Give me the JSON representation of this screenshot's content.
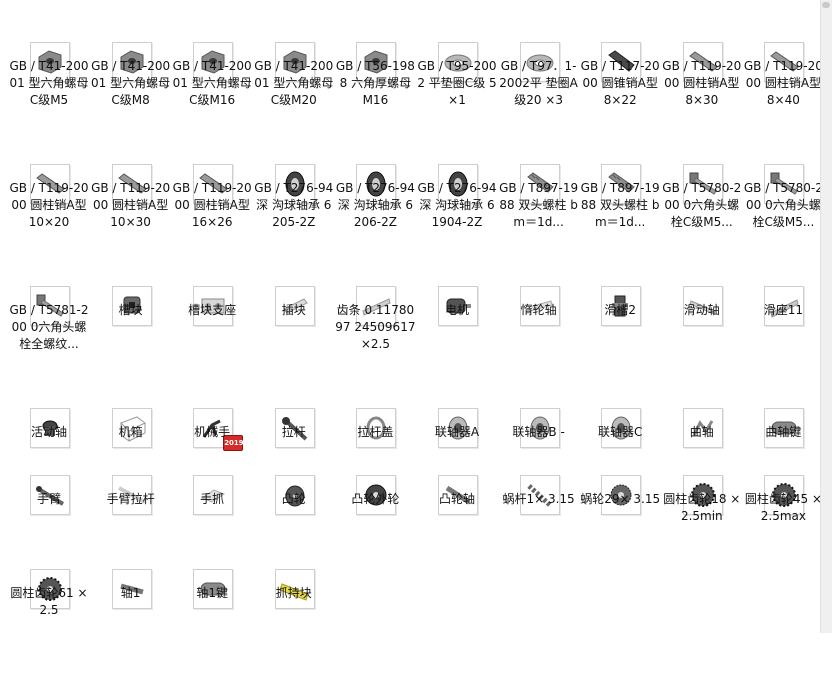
{
  "items": [
    {
      "label": "GB / T41-20001 型六角螺母 C级M5",
      "icon": "hex-nut-icon"
    },
    {
      "label": "GB / T41-20001 型六角螺母 C级M8",
      "icon": "hex-nut-icon"
    },
    {
      "label": "GB / T41-20001 型六角螺母 C级M16",
      "icon": "hex-nut-icon"
    },
    {
      "label": "GB / T41-20001 型六角螺母 C级M20",
      "icon": "hex-nut-icon"
    },
    {
      "label": "GB / T56-1988 六角厚螺母 M16",
      "icon": "hex-nut-icon"
    },
    {
      "label": "GB / T95-2002 平垫圈C级 5×1",
      "icon": "washer-icon"
    },
    {
      "label": "GB / T97．1-2002平 垫圈A级20 ×3",
      "icon": "washer-icon"
    },
    {
      "label": "GB / T117-2000 圆锥销A型 8×22",
      "icon": "taper-pin-icon"
    },
    {
      "label": "GB / T119-2000 圆柱销A型 8×30",
      "icon": "cylinder-pin-icon"
    },
    {
      "label": "GB / T119-2000 圆柱销A型 8×40",
      "icon": "cylinder-pin-icon"
    },
    {
      "label": "GB / T119-2000 圆柱销A型 10×20",
      "icon": "cylinder-pin-icon"
    },
    {
      "label": "GB / T119-2000 圆柱销A型 10×30",
      "icon": "cylinder-pin-icon"
    },
    {
      "label": "GB / T119-2000 圆柱销A型 16×26",
      "icon": "cylinder-pin-icon"
    },
    {
      "label": "GB / T276-94深 沟球轴承 6205-2Z",
      "icon": "bearing-icon"
    },
    {
      "label": "GB / T276-94深 沟球轴承 6206-2Z",
      "icon": "bearing-icon"
    },
    {
      "label": "GB / T276-94深 沟球轴承 61904-2Z",
      "icon": "bearing-icon"
    },
    {
      "label": "GB / T897-1988 双头螺柱 bm＝1d...",
      "icon": "stud-icon"
    },
    {
      "label": "GB / T897-1988 双头螺柱 bm＝1d...",
      "icon": "stud-icon"
    },
    {
      "label": "GB / T5780-200 0六角头螺 栓C级M5...",
      "icon": "bolt-icon"
    },
    {
      "label": "GB / T5780-200 0六角头螺 栓C级M5...",
      "icon": "bolt-icon"
    },
    {
      "label": "GB / T5781-200 0六角头螺 栓全螺纹...",
      "icon": "bolt-icon"
    },
    {
      "label": "槽块",
      "icon": "slot-block-icon"
    },
    {
      "label": "槽块支座",
      "icon": "slot-block-support-icon"
    },
    {
      "label": "插块",
      "icon": "insert-block-icon"
    },
    {
      "label": "齿条 0.1178097 24509617 ×2.5",
      "icon": "rack-icon"
    },
    {
      "label": "电机",
      "icon": "motor-icon"
    },
    {
      "label": "惰轮轴",
      "icon": "idler-shaft-icon"
    },
    {
      "label": "滑槽2",
      "icon": "chute-icon"
    },
    {
      "label": "滑动轴",
      "icon": "sliding-shaft-icon"
    },
    {
      "label": "滑座11",
      "icon": "slide-seat-icon"
    },
    {
      "label": "活动轴",
      "icon": "movable-shaft-icon"
    },
    {
      "label": "机箱",
      "icon": "chassis-icon"
    },
    {
      "label": "机械手",
      "icon": "manipulator-icon",
      "badge": "2019"
    },
    {
      "label": "拉杆",
      "icon": "pull-rod-icon"
    },
    {
      "label": "拉杆盖",
      "icon": "pull-rod-cover-icon"
    },
    {
      "label": "联轴器A",
      "icon": "coupling-icon"
    },
    {
      "label": "联轴器B -",
      "icon": "coupling-icon"
    },
    {
      "label": "联轴器C",
      "icon": "coupling-icon"
    },
    {
      "label": "曲轴",
      "icon": "crankshaft-icon"
    },
    {
      "label": "曲轴键",
      "icon": "key-icon"
    },
    {
      "label": "手臂",
      "icon": "arm-icon"
    },
    {
      "label": "手臂拉杆",
      "icon": "arm-rod-icon"
    },
    {
      "label": "手抓",
      "icon": "gripper-icon"
    },
    {
      "label": "凸轮",
      "icon": "cam-icon"
    },
    {
      "label": "凸轮外轮",
      "icon": "cam-outer-wheel-icon"
    },
    {
      "label": "凸轮轴",
      "icon": "cam-shaft-icon"
    },
    {
      "label": "蜗杆1× 3.15",
      "icon": "worm-icon"
    },
    {
      "label": "蜗轮29× 3.15",
      "icon": "worm-wheel-icon"
    },
    {
      "label": "圆柱齿轮18 ×2.5min",
      "icon": "gear-icon"
    },
    {
      "label": "圆柱齿轮45 ×2.5max",
      "icon": "gear-icon"
    },
    {
      "label": "圆柱齿轮61 ×2.5",
      "icon": "gear-icon"
    },
    {
      "label": "轴1",
      "icon": "shaft-icon"
    },
    {
      "label": "轴1键",
      "icon": "key-icon"
    },
    {
      "label": "抓持块",
      "icon": "grip-block-icon"
    }
  ]
}
